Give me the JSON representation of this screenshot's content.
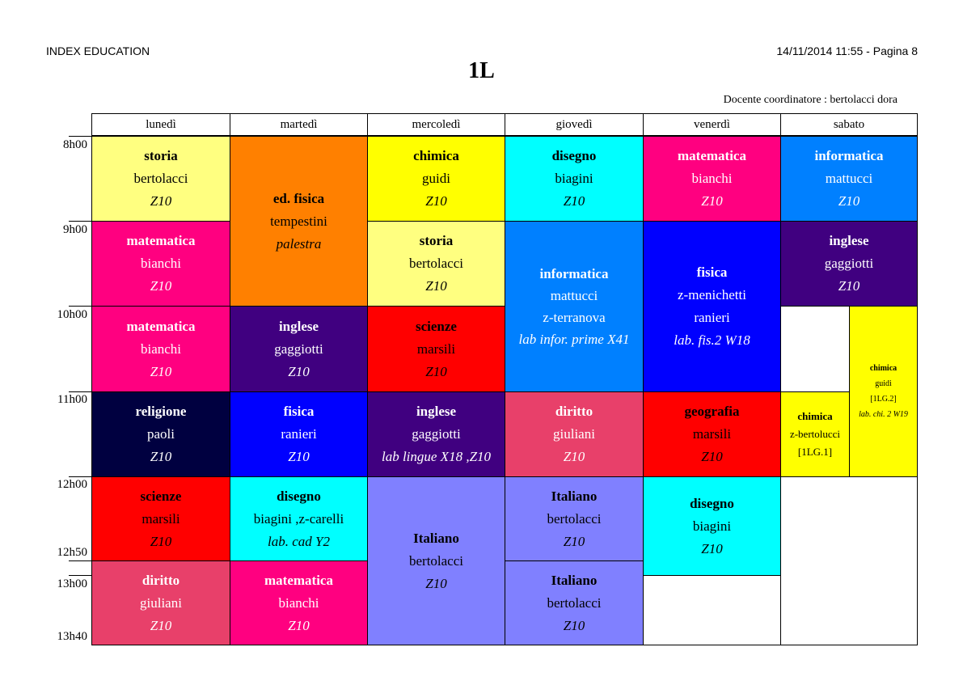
{
  "header": {
    "left": "INDEX EDUCATION",
    "right": "14/11/2014 11:55 - Pagina 8"
  },
  "title": "1L",
  "coordinator": "Docente coordinatore : bertolacci dora",
  "days": [
    "lunedì",
    "martedì",
    "mercoledì",
    "giovedì",
    "venerdì",
    "sabato"
  ],
  "times": [
    "8h00",
    "9h00",
    "10h00",
    "11h00",
    "12h00",
    "12h50",
    "13h00",
    "13h40"
  ],
  "lessons": {
    "mon1": {
      "subject": "storia",
      "teacher": "bertolacci",
      "room": "Z10"
    },
    "mon2": {
      "subject": "matematica",
      "teacher": "bianchi",
      "room": "Z10"
    },
    "mon3": {
      "subject": "matematica",
      "teacher": "bianchi",
      "room": "Z10"
    },
    "mon4": {
      "subject": "religione",
      "teacher": "paoli",
      "room": "Z10"
    },
    "mon5": {
      "subject": "scienze",
      "teacher": "marsili",
      "room": "Z10"
    },
    "mon6": {
      "subject": "diritto",
      "teacher": "giuliani",
      "room": "Z10"
    },
    "tue1": {
      "subject": "ed. fisica",
      "teacher": "tempestini",
      "room": "palestra"
    },
    "tue3": {
      "subject": "inglese",
      "teacher": "gaggiotti",
      "room": "Z10"
    },
    "tue4": {
      "subject": "fisica",
      "teacher": "ranieri",
      "room": "Z10"
    },
    "tue5": {
      "subject": "disegno",
      "teacher": "biagini ,z-carelli",
      "room": "lab. cad Y2"
    },
    "tue6": {
      "subject": "matematica",
      "teacher": "bianchi",
      "room": "Z10"
    },
    "wed1": {
      "subject": "chimica",
      "teacher": "guidi",
      "room": "Z10"
    },
    "wed2": {
      "subject": "storia",
      "teacher": "bertolacci",
      "room": "Z10"
    },
    "wed3": {
      "subject": "scienze",
      "teacher": "marsili",
      "room": "Z10"
    },
    "wed4": {
      "subject": "inglese",
      "teacher": "gaggiotti",
      "room": "lab lingue X18  ,Z10"
    },
    "wed5": {
      "subject": "Italiano",
      "teacher": "bertolacci",
      "room": "Z10"
    },
    "thu1": {
      "subject": "disegno",
      "teacher": "biagini",
      "room": "Z10"
    },
    "thu2": {
      "subject": "informatica",
      "teacher": "mattucci",
      "teacher2": "z-terranova",
      "room": "lab infor. prime X41"
    },
    "thu4": {
      "subject": "diritto",
      "teacher": "giuliani",
      "room": "Z10"
    },
    "thu5": {
      "subject": "Italiano",
      "teacher": "bertolacci",
      "room": "Z10"
    },
    "thu6": {
      "subject": "Italiano",
      "teacher": "bertolacci",
      "room": "Z10"
    },
    "fri1": {
      "subject": "matematica",
      "teacher": "bianchi",
      "room": "Z10"
    },
    "fri2": {
      "subject": "fisica",
      "teacher": "z-menichetti",
      "teacher2": "ranieri",
      "room": "lab. fis.2 W18"
    },
    "fri4": {
      "subject": "geografia",
      "teacher": "marsili",
      "room": "Z10"
    },
    "fri5": {
      "subject": "disegno",
      "teacher": "biagini",
      "room": "Z10"
    },
    "sat1": {
      "subject": "informatica",
      "teacher": "mattucci",
      "room": "Z10"
    },
    "sat2": {
      "subject": "inglese",
      "teacher": "gaggiotti",
      "room": "Z10"
    },
    "sat4a": {
      "subject": "chimica",
      "teacher": "z-bertolucci",
      "room": "[1LG.1]"
    },
    "sat3b": {
      "subject": "chimica",
      "teacher": "guidi",
      "group": "[1LG.2]",
      "room": "lab. chi. 2 W19"
    }
  },
  "colors": {
    "yellow_light": "#ffff80",
    "orange": "#ff8000",
    "yellow": "#ffff00",
    "cyan": "#00ffff",
    "pink": "#ff0080",
    "azure": "#0080ff",
    "indigo": "#400080",
    "blue": "#0000ff",
    "red": "#ff0000",
    "navy": "#000040",
    "rose": "#e8406a",
    "periwinkle": "#8080ff"
  }
}
